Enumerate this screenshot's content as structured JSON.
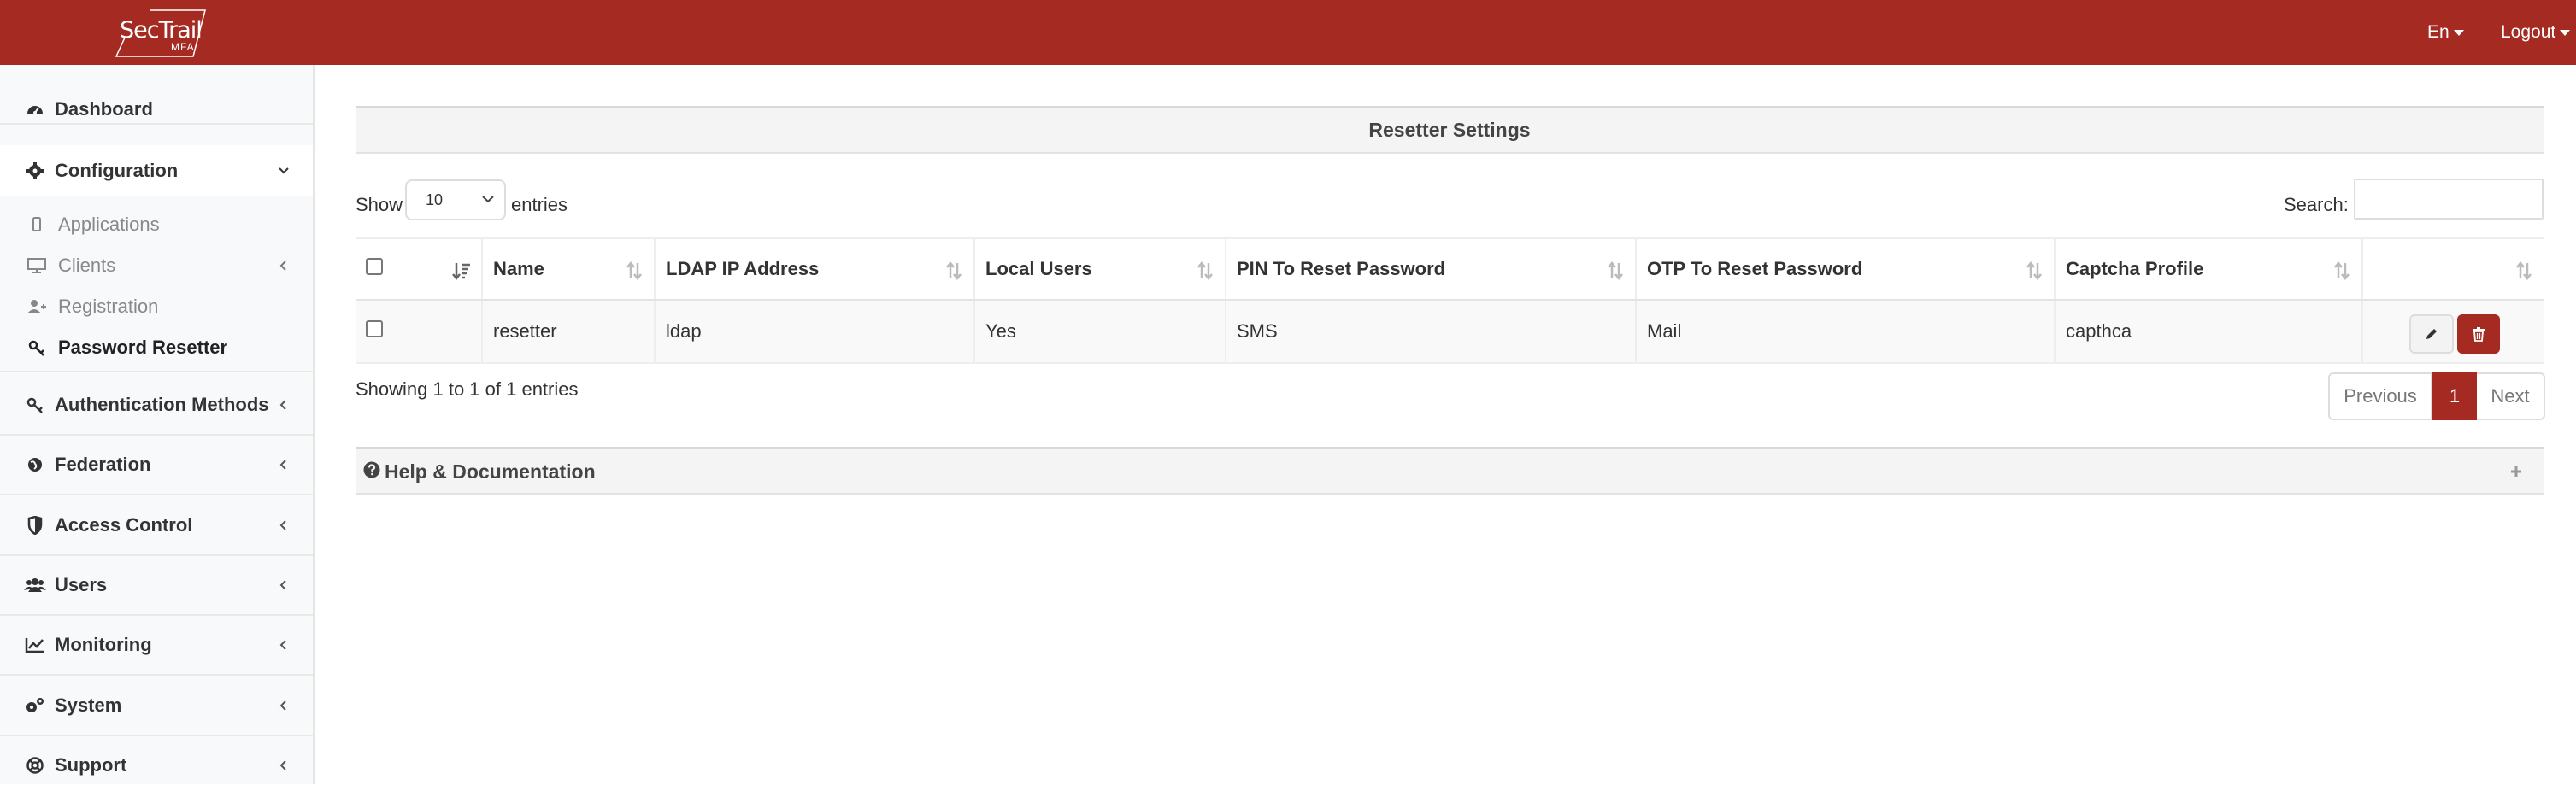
{
  "header": {
    "brand": "SecTrail",
    "brand_sub": "MFA",
    "language": "En",
    "logout": "Logout"
  },
  "sidebar": {
    "dashboard": "Dashboard",
    "configuration": "Configuration",
    "applications": "Applications",
    "clients": "Clients",
    "registration": "Registration",
    "password_resetter": "Password Resetter",
    "authentication_methods": "Authentication Methods",
    "federation": "Federation",
    "access_control": "Access Control",
    "users": "Users",
    "monitoring": "Monitoring",
    "system": "System",
    "support": "Support"
  },
  "panel": {
    "title": "Resetter Settings"
  },
  "controls": {
    "show_label": "Show",
    "page_size": "10",
    "entries_label": "entries",
    "search_label": "Search:",
    "search_value": ""
  },
  "table": {
    "columns": [
      "Name",
      "LDAP IP Address",
      "Local Users",
      "PIN To Reset Password",
      "OTP To Reset Password",
      "Captcha Profile"
    ],
    "rows": [
      {
        "name": "resetter",
        "ldap": "ldap",
        "local_users": "Yes",
        "pin": "SMS",
        "otp": "Mail",
        "captcha": "capthca"
      }
    ]
  },
  "footer": {
    "info": "Showing 1 to 1 of 1 entries",
    "previous": "Previous",
    "current_page": "1",
    "next": "Next"
  },
  "help": {
    "title": "Help & Documentation"
  },
  "colors": {
    "brand": "#a52a22"
  }
}
